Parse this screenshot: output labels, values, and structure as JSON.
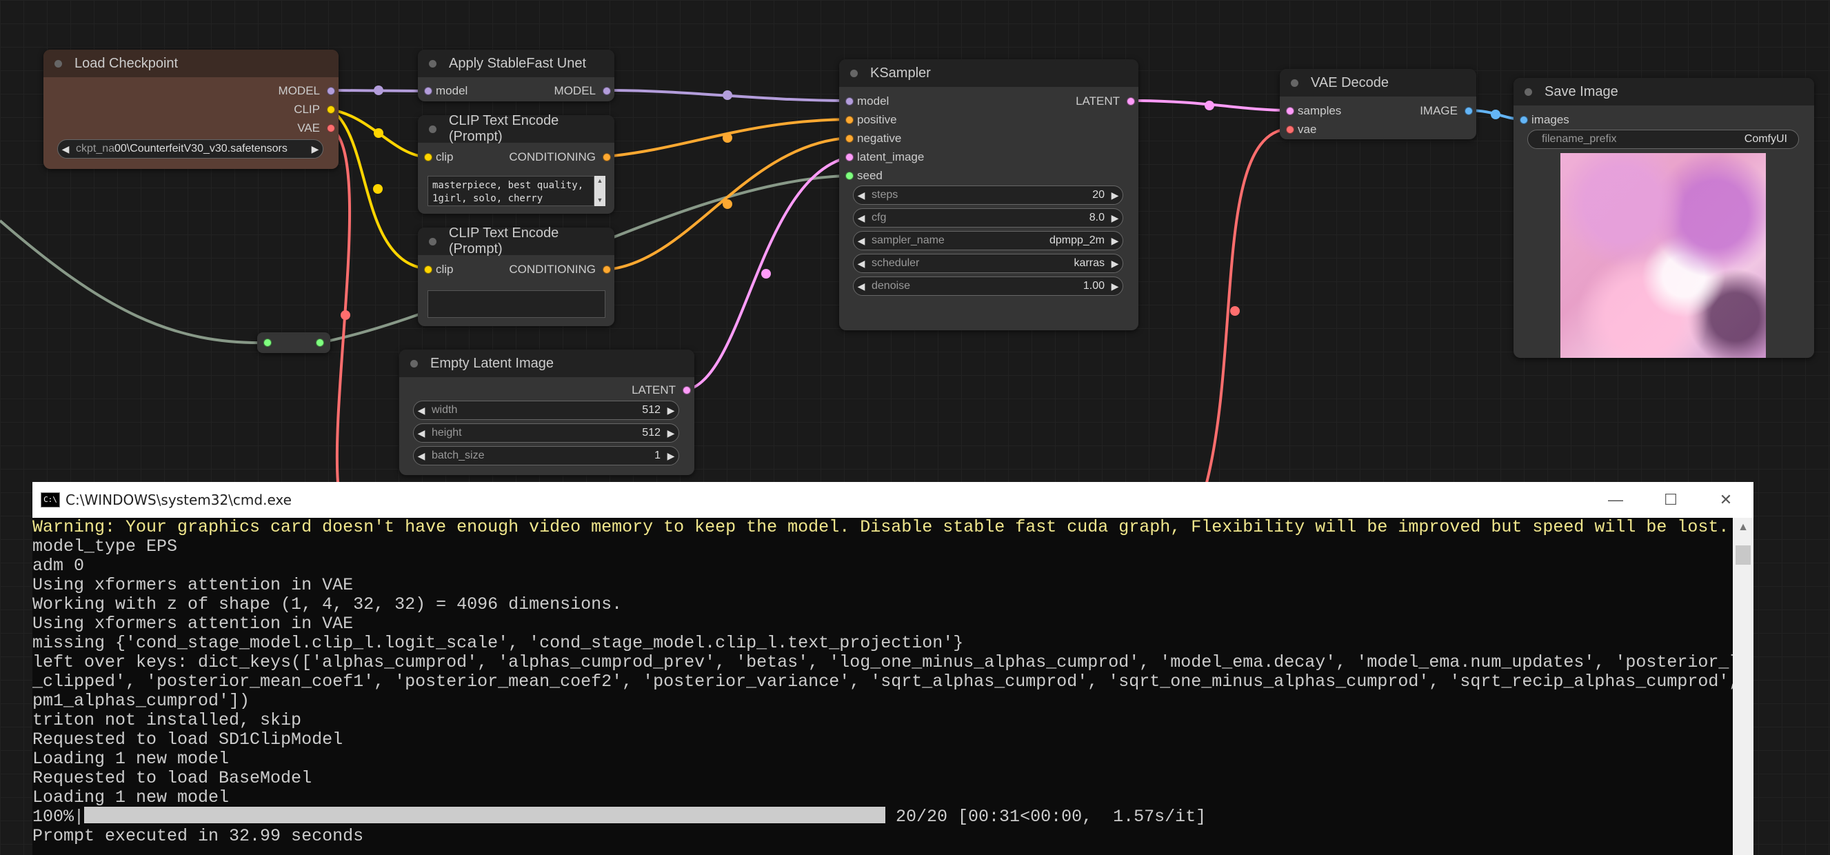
{
  "nodes": {
    "load_checkpoint": {
      "title": "Load Checkpoint",
      "outputs": [
        "MODEL",
        "CLIP",
        "VAE"
      ],
      "ckpt_label": "ckpt_na",
      "ckpt_value": "00\\CounterfeitV30_v30.safetensors"
    },
    "apply_stablefast": {
      "title": "Apply StableFast Unet",
      "input": "model",
      "output": "MODEL"
    },
    "clip_text_1": {
      "title": "CLIP Text Encode (Prompt)",
      "input": "clip",
      "output": "CONDITIONING",
      "text": "masterpiece, best quality,\n1girl, solo, cherry"
    },
    "clip_text_2": {
      "title": "CLIP Text Encode (Prompt)",
      "input": "clip",
      "output": "CONDITIONING",
      "text": ""
    },
    "empty_latent": {
      "title": "Empty Latent Image",
      "output": "LATENT",
      "widgets": [
        {
          "label": "width",
          "value": "512"
        },
        {
          "label": "height",
          "value": "512"
        },
        {
          "label": "batch_size",
          "value": "1"
        }
      ]
    },
    "ksampler": {
      "title": "KSampler",
      "inputs": [
        "model",
        "positive",
        "negative",
        "latent_image",
        "seed"
      ],
      "output": "LATENT",
      "widgets": [
        {
          "label": "steps",
          "value": "20"
        },
        {
          "label": "cfg",
          "value": "8.0"
        },
        {
          "label": "sampler_name",
          "value": "dpmpp_2m"
        },
        {
          "label": "scheduler",
          "value": "karras"
        },
        {
          "label": "denoise",
          "value": "1.00"
        }
      ]
    },
    "vae_decode": {
      "title": "VAE Decode",
      "inputs": [
        "samples",
        "vae"
      ],
      "output": "IMAGE"
    },
    "save_image": {
      "title": "Save Image",
      "input": "images",
      "prefix_label": "filename_prefix",
      "prefix_value": "ComfyUI"
    }
  },
  "slot_colors": {
    "model": "#b39ddb",
    "clip": "#ffd500",
    "vae": "#ff6e6e",
    "conditioning": "#ffa931",
    "latent": "#ff9cf9",
    "image": "#64b5f6",
    "int": "#7fff7f",
    "link_gray": "#889988"
  },
  "cmd": {
    "icon_text": "C:\\",
    "title": "C:\\WINDOWS\\system32\\cmd.exe",
    "minimize": "—",
    "maximize": "☐",
    "close": "✕",
    "warning": "Warning: Your graphics card doesn't have enough video memory to keep the model. Disable stable fast cuda graph, Flexibility will be improved but speed will be lost.",
    "lines": [
      "model_type EPS",
      "adm 0",
      "Using xformers attention in VAE",
      "Working with z of shape (1, 4, 32, 32) = 4096 dimensions.",
      "Using xformers attention in VAE",
      "missing {'cond_stage_model.clip_l.logit_scale', 'cond_stage_model.clip_l.text_projection'}",
      "left over keys: dict_keys(['alphas_cumprod', 'alphas_cumprod_prev', 'betas', 'log_one_minus_alphas_cumprod', 'model_ema.decay', 'model_ema.num_updates', 'posterior_log_variance",
      "_clipped', 'posterior_mean_coef1', 'posterior_mean_coef2', 'posterior_variance', 'sqrt_alphas_cumprod', 'sqrt_one_minus_alphas_cumprod', 'sqrt_recip_alphas_cumprod', 'sqrt_reci",
      "pm1_alphas_cumprod'])",
      "triton not installed, skip",
      "Requested to load SD1ClipModel",
      "Loading 1 new model",
      "Requested to load BaseModel",
      "Loading 1 new model"
    ],
    "progress_pct": "100%",
    "progress_fraction": 1.0,
    "progress_stats": " 20/20 [00:31<00:00,  1.57s/it]",
    "final": "Prompt executed in 32.99 seconds"
  }
}
